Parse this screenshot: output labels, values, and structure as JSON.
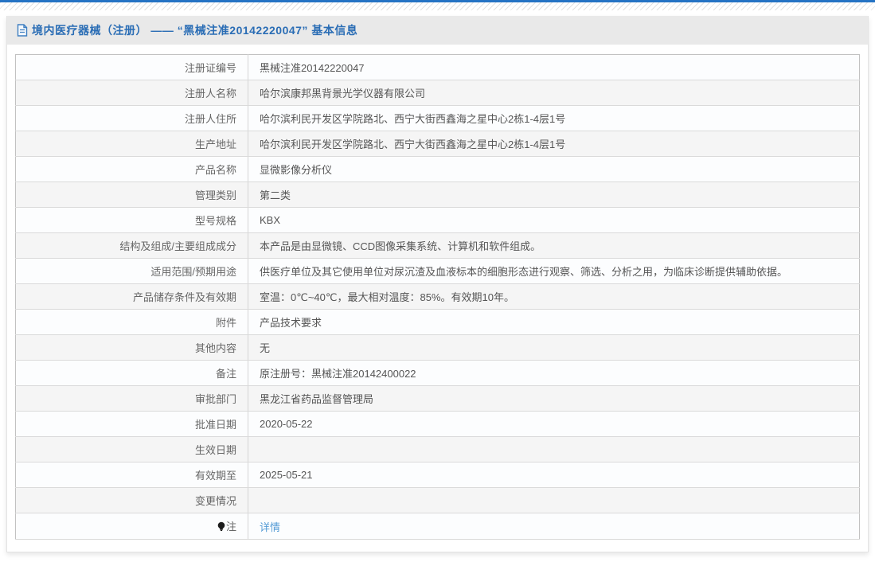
{
  "colors": {
    "accent_blue": "#2573c4",
    "title_blue": "#2a6db5",
    "link_blue": "#549bd5",
    "header_strip_gray": "#e9e9e9",
    "row_alt_gray": "#f5f5f5"
  },
  "header": {
    "icon": "document-icon",
    "title": "境内医疗器械（注册） —— “黑械注准20142220047” 基本信息"
  },
  "table": {
    "rows": [
      {
        "label": "注册证编号",
        "value": "黑械注准20142220047"
      },
      {
        "label": "注册人名称",
        "value": "哈尔滨康邦黑背景光学仪器有限公司"
      },
      {
        "label": "注册人住所",
        "value": "哈尔滨利民开发区学院路北、西宁大街西鑫海之星中心2栋1-4层1号"
      },
      {
        "label": "生产地址",
        "value": "哈尔滨利民开发区学院路北、西宁大街西鑫海之星中心2栋1-4层1号"
      },
      {
        "label": "产品名称",
        "value": "显微影像分析仪"
      },
      {
        "label": "管理类别",
        "value": "第二类"
      },
      {
        "label": "型号规格",
        "value": "KBX"
      },
      {
        "label": "结构及组成/主要组成成分",
        "value": "本产品是由显微镜、CCD图像采集系统、计算机和软件组成。"
      },
      {
        "label": "适用范围/预期用途",
        "value": "供医疗单位及其它使用单位对尿沉渣及血液标本的细胞形态进行观察、筛选、分析之用，为临床诊断提供辅助依据。"
      },
      {
        "label": "产品储存条件及有效期",
        "value": "室温：0℃~40℃，最大相对温度：85%。有效期10年。"
      },
      {
        "label": "附件",
        "value": "产品技术要求"
      },
      {
        "label": "其他内容",
        "value": "无"
      },
      {
        "label": "备注",
        "value": "原注册号：黑械注准20142400022"
      },
      {
        "label": "审批部门",
        "value": "黑龙江省药品监督管理局"
      },
      {
        "label": "批准日期",
        "value": "2020-05-22"
      },
      {
        "label": "生效日期",
        "value": ""
      },
      {
        "label": "有效期至",
        "value": "2025-05-21"
      },
      {
        "label": "变更情况",
        "value": ""
      },
      {
        "label": "注",
        "value": "详情",
        "label_icon": "bulb-icon",
        "value_is_link": true
      }
    ]
  }
}
